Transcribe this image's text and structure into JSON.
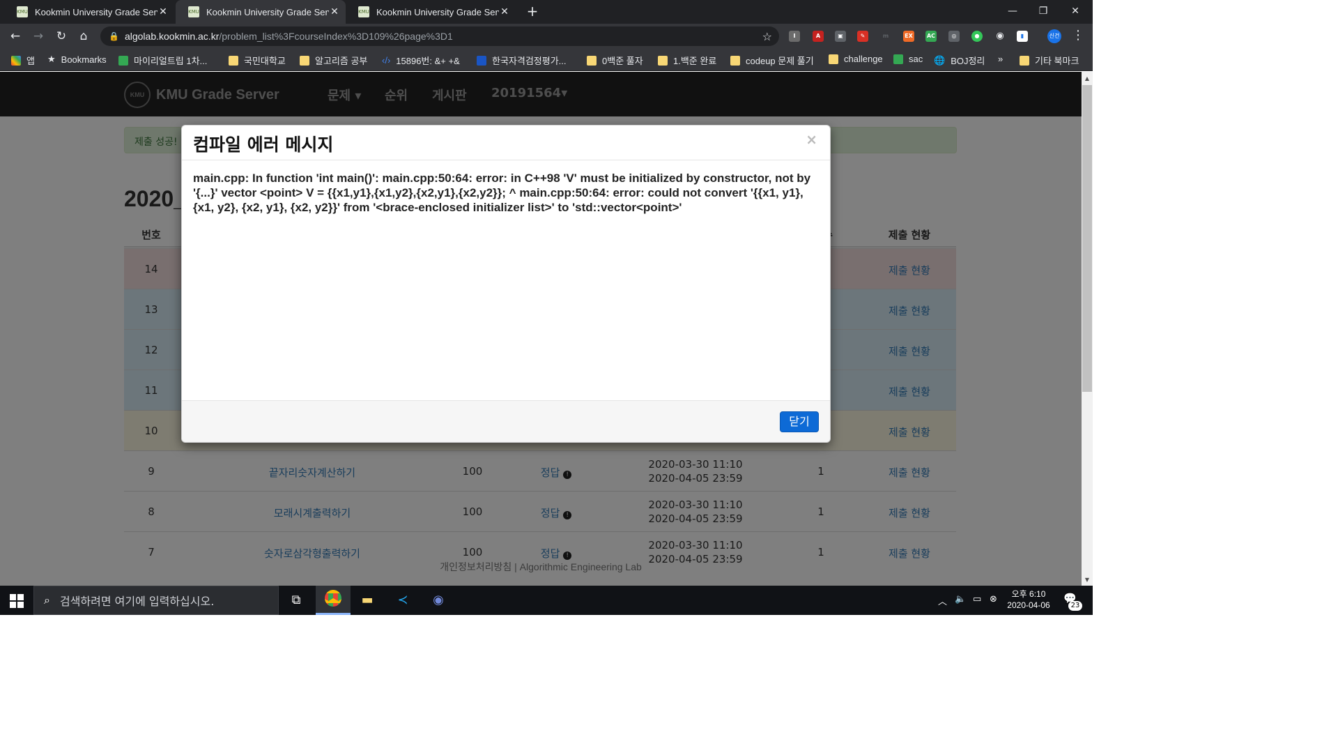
{
  "browser": {
    "tabs": [
      {
        "title": "Kookmin University Grade Serve",
        "close": "✕"
      },
      {
        "title": "Kookmin University Grade Serve",
        "close": "✕"
      },
      {
        "title": "Kookmin University Grade Serve",
        "close": "✕"
      }
    ],
    "new_tab": "+",
    "window_controls": {
      "minimize": "—",
      "restore": "❐",
      "close": "✕"
    },
    "url_host": "algolab.kookmin.ac.kr",
    "url_path": "/problem_list%3FcourseIndex%3D109%26page%3D1",
    "profile_label": "신건",
    "bookmarks": [
      "앱",
      "Bookmarks",
      "마이리얼트립 1차...",
      "국민대학교",
      "알고리즘 공부",
      "15896번: &+ +&",
      "한국자격검정평가...",
      "0백준 풀자",
      "1.백준 완료",
      "codeup 문제 풀기",
      "challenge",
      "sac",
      "BOJ정리",
      "»",
      "기타 북마크"
    ]
  },
  "site": {
    "brand": "KMU Grade Server",
    "nav": [
      "문제",
      "순위",
      "게시판",
      "20191564"
    ],
    "alert": "제출 성공!",
    "page_title": "2020_",
    "table": {
      "headers": {
        "num": "번호",
        "score": "수",
        "status": "제출 현황"
      },
      "rows": [
        {
          "num": "14",
          "status": "제출 현황"
        },
        {
          "num": "13",
          "status": "제출 현황"
        },
        {
          "num": "12",
          "status": "제출 현황"
        },
        {
          "num": "11",
          "status": "제출 현황"
        },
        {
          "num": "10",
          "status": "제출 현황"
        },
        {
          "num": "9",
          "title": "끝자리숫자계산하기",
          "points": "100",
          "result": "정답",
          "start": "2020-03-30 11:10",
          "end": "2020-04-05 23:59",
          "count": "1",
          "status": "제출 현황"
        },
        {
          "num": "8",
          "title": "모래시계출력하기",
          "points": "100",
          "result": "정답",
          "start": "2020-03-30 11:10",
          "end": "2020-04-05 23:59",
          "count": "1",
          "status": "제출 현황"
        },
        {
          "num": "7",
          "title": "숫자로삼각형출력하기",
          "points": "100",
          "result": "정답",
          "start": "2020-03-30 11:10",
          "end": "2020-04-05 23:59",
          "count": "1",
          "status": "제출 현황"
        }
      ]
    },
    "footer": "개인정보처리방침 | Algorithmic Engineering Lab"
  },
  "modal": {
    "title": "컴파일 에러 메시지",
    "close_x": "×",
    "message": "main.cpp: In function 'int main()': main.cpp:50:64: error: in C++98 'V' must be initialized by constructor, not by '{...}' vector <point> V = {{x1,y1},{x1,y2},{x2,y1},{x2,y2}}; ^ main.cpp:50:64: error: could not convert '{{x1, y1}, {x1, y2}, {x2, y1}, {x2, y2}}' from '<brace-enclosed initializer list>' to 'std::vector<point>'",
    "close_button": "닫기"
  },
  "taskbar": {
    "search_placeholder": "검색하려면 여기에 입력하십시오.",
    "time": "오후 6:10",
    "date": "2020-04-06",
    "notification_count": "23"
  },
  "colors": {
    "accent": "#0d6ad6",
    "danger_row": "#f2dede",
    "navbar": "#222222"
  }
}
